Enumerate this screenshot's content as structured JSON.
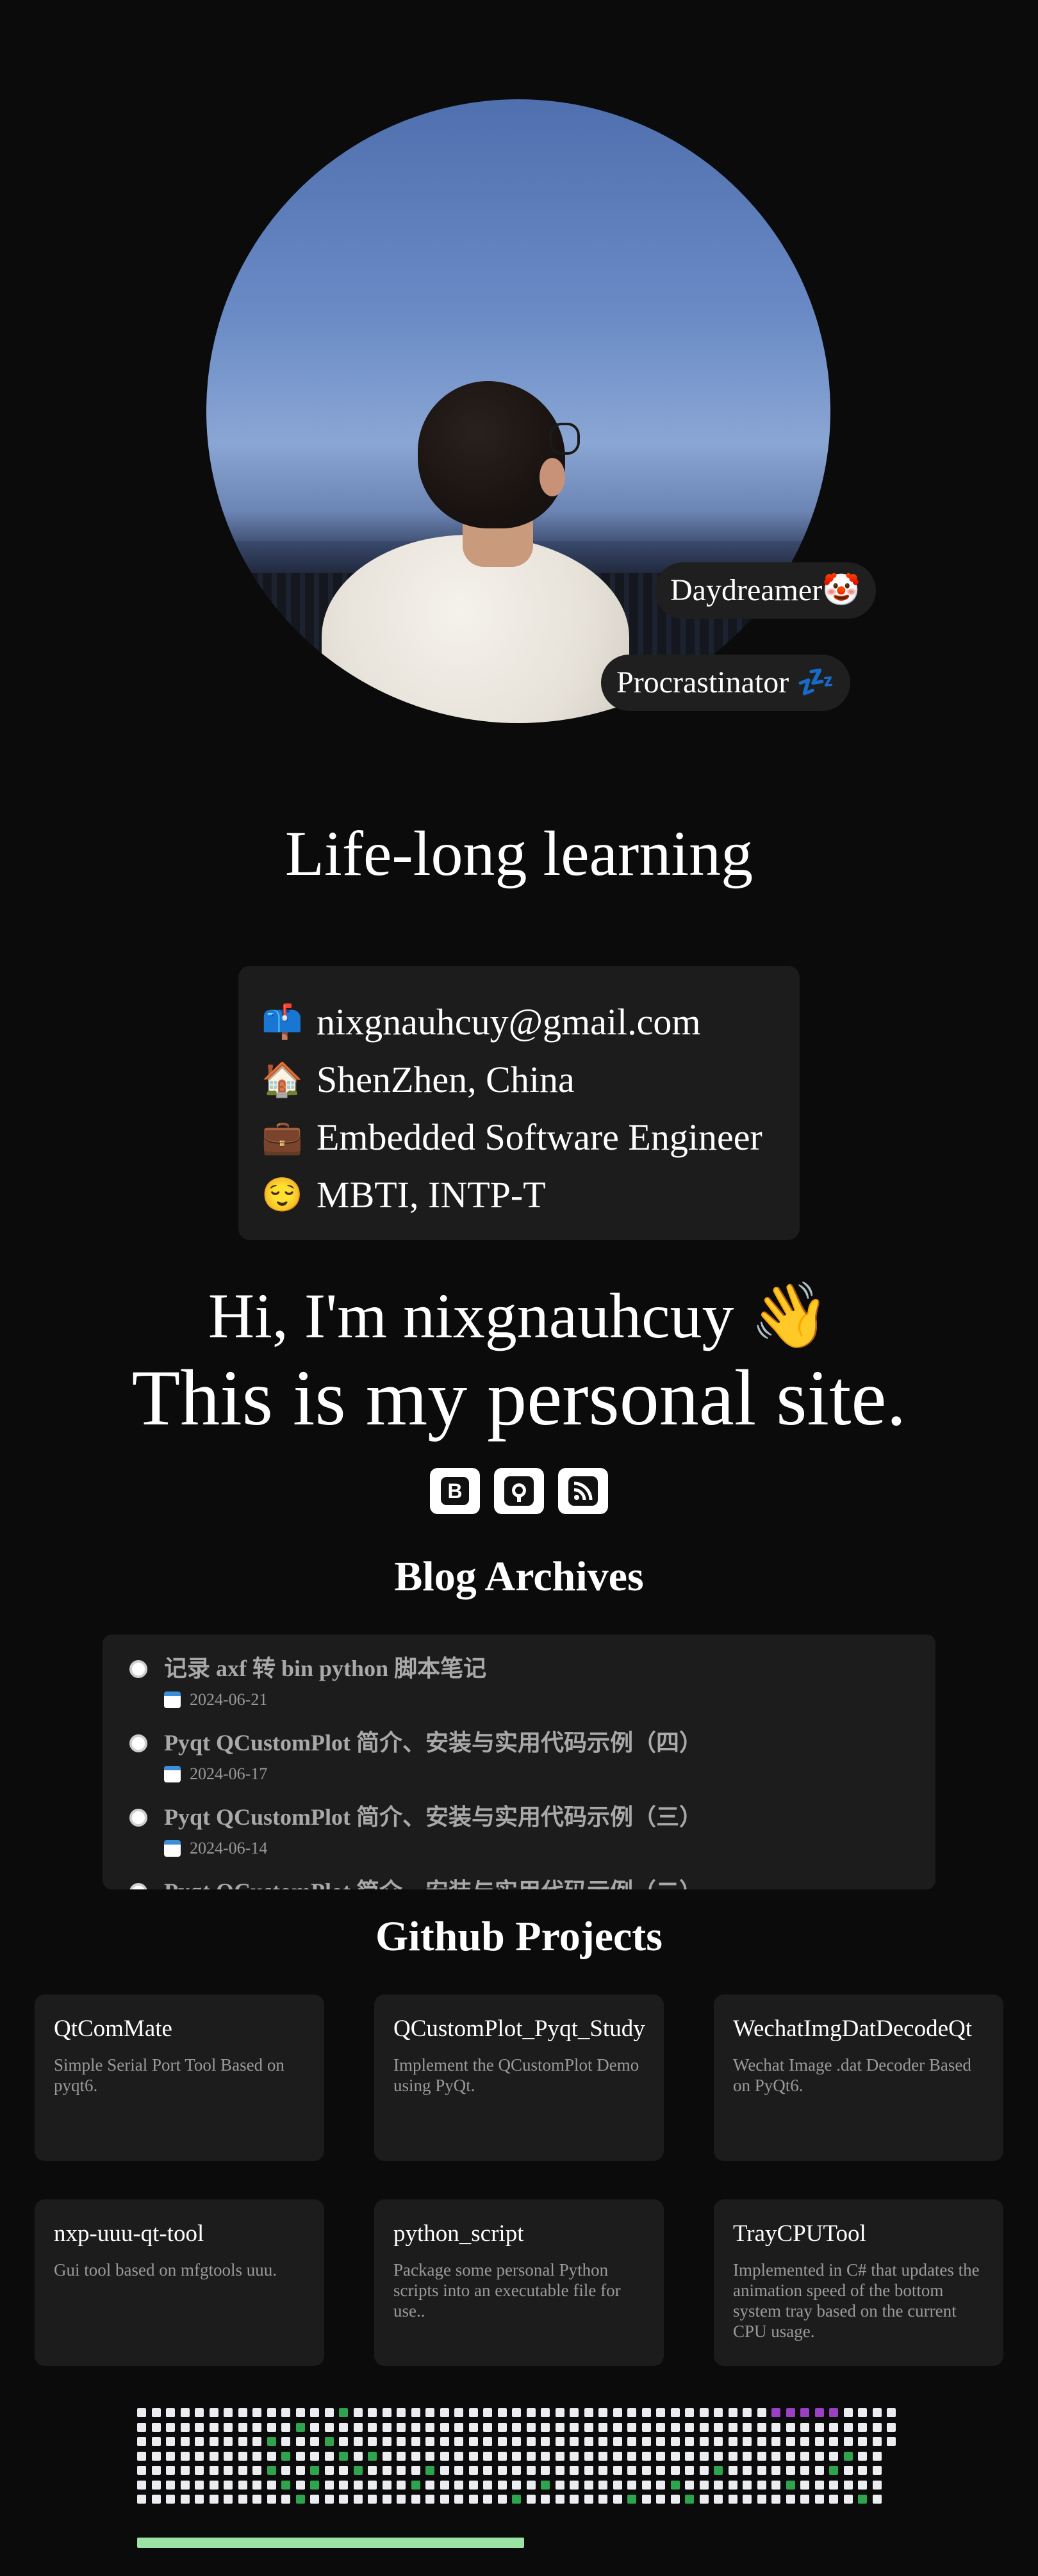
{
  "profile": {
    "badges": [
      "Daydreamer🤡",
      "Procrastinator 💤"
    ],
    "motto": "Life-long learning"
  },
  "info": [
    {
      "icon": "📫",
      "icon_name": "mailbox-icon",
      "text": "nixgnauhcuy@gmail.com"
    },
    {
      "icon": "🏠",
      "icon_name": "house-icon",
      "text": "ShenZhen, China"
    },
    {
      "icon": "💼",
      "icon_name": "briefcase-icon",
      "text": "Embedded Software Engineer"
    },
    {
      "icon": "😌",
      "icon_name": "smile-icon",
      "text": "MBTI, INTP-T"
    }
  ],
  "intro": {
    "hi": "Hi, I'm nixgnauhcuy 👋",
    "site": "This is my personal site."
  },
  "social_icons": [
    {
      "name": "blog-icon",
      "glyph": "B"
    },
    {
      "name": "github-icon",
      "glyph": "◉"
    },
    {
      "name": "rss-icon",
      "glyph": "◜"
    }
  ],
  "blog": {
    "title": "Blog Archives",
    "posts": [
      {
        "title": "记录 axf 转 bin python 脚本笔记",
        "date": "2024-06-21"
      },
      {
        "title": "Pyqt QCustomPlot 简介、安装与实用代码示例（四）",
        "date": "2024-06-17"
      },
      {
        "title": "Pyqt QCustomPlot 简介、安装与实用代码示例（三）",
        "date": "2024-06-14"
      },
      {
        "title": "Pyqt QCustomPlot 简介、安装与实用代码示例（二）",
        "date": ""
      }
    ]
  },
  "github": {
    "title": "Github Projects",
    "projects": [
      {
        "name": "QtComMate",
        "desc": "Simple Serial Port Tool Based on pyqt6."
      },
      {
        "name": "QCustomPlot_Pyqt_Study",
        "desc": "Implement the QCustomPlot Demo using PyQt."
      },
      {
        "name": "WechatImgDatDecodeQt",
        "desc": "Wechat Image .dat Decoder Based on PyQt6."
      },
      {
        "name": "nxp-uuu-qt-tool",
        "desc": "Gui tool based on mfgtools uuu."
      },
      {
        "name": "python_script",
        "desc": "Package some personal Python scripts into an executable file for use.."
      },
      {
        "name": "TrayCPUTool",
        "desc": "Implemented in C# that updates the animation speed of the bottom system tray based on the current CPU usage."
      }
    ]
  },
  "colors": {
    "background": "#0b0b0b",
    "card": "#1c1c1c",
    "contrib_empty": "#ebedf0",
    "contrib_level": "#2ea44f",
    "contrib_highlight": "#9b3fc5",
    "progress": "#9be3a4"
  }
}
